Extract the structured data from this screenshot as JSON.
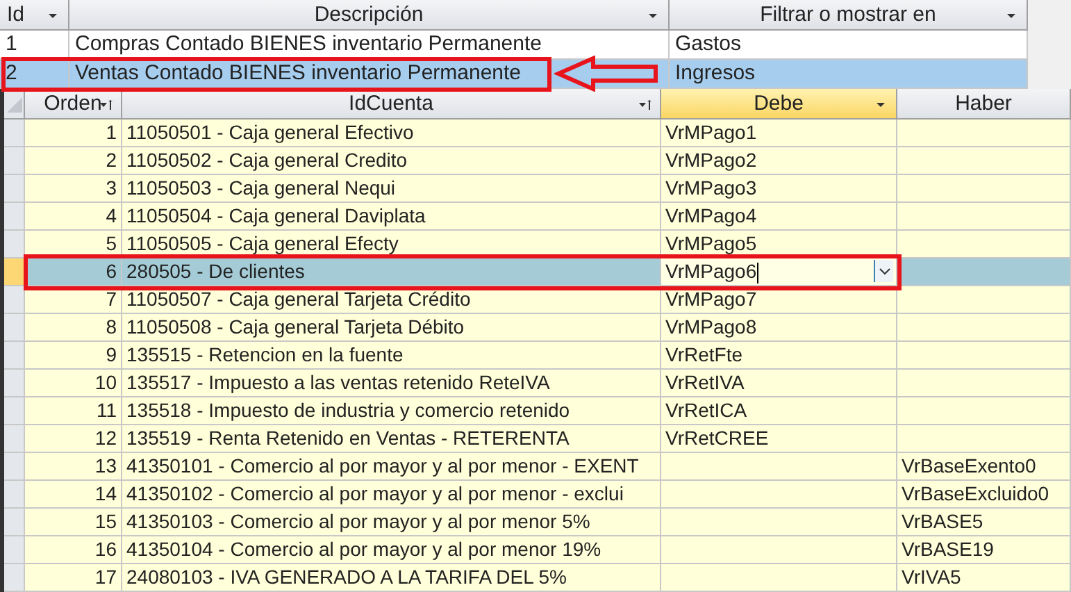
{
  "master": {
    "columns": [
      {
        "label": "Id",
        "kind": "filter"
      },
      {
        "label": "Descripción",
        "kind": "filter"
      },
      {
        "label": "Filtrar o mostrar en",
        "kind": "filter"
      }
    ],
    "rows": [
      {
        "id": "1",
        "descripcion": "Compras Contado BIENES inventario Permanente",
        "filtrar": "Gastos",
        "selected": false,
        "annotated": false
      },
      {
        "id": "2",
        "descripcion": "Ventas Contado BIENES inventario Permanente",
        "filtrar": "Ingresos",
        "selected": true,
        "annotated": true
      }
    ]
  },
  "detail": {
    "columns": [
      {
        "label": "Orden",
        "kind": "sorted",
        "selected": false
      },
      {
        "label": "IdCuenta",
        "kind": "sorted",
        "selected": false
      },
      {
        "label": "Debe",
        "kind": "filter",
        "selected": true
      },
      {
        "label": "Haber",
        "kind": "plain",
        "selected": false
      }
    ],
    "rows": [
      {
        "orden": "1",
        "idcuenta": "11050501 - Caja general Efectivo",
        "debe": "VrMPago1",
        "selected": false
      },
      {
        "orden": "2",
        "idcuenta": "11050502 - Caja general Credito",
        "debe": "VrMPago2",
        "selected": false
      },
      {
        "orden": "3",
        "idcuenta": "11050503 - Caja general Nequi",
        "debe": "VrMPago3",
        "selected": false
      },
      {
        "orden": "4",
        "idcuenta": "11050504 - Caja general Daviplata",
        "debe": "VrMPago4",
        "selected": false
      },
      {
        "orden": "5",
        "idcuenta": "11050505 - Caja general Efecty",
        "debe": "VrMPago5",
        "selected": false
      },
      {
        "orden": "6",
        "idcuenta": "280505 - De clientes",
        "debe": "VrMPago6",
        "selected": true,
        "editing": true,
        "annotated": true
      },
      {
        "orden": "7",
        "idcuenta": "11050507 - Caja general Tarjeta Crédito",
        "debe": "VrMPago7",
        "selected": false
      },
      {
        "orden": "8",
        "idcuenta": "11050508 - Caja general Tarjeta Débito",
        "debe": "VrMPago8",
        "selected": false
      },
      {
        "orden": "9",
        "idcuenta": "135515 - Retencion en la fuente",
        "debe": "VrRetFte",
        "selected": false
      },
      {
        "orden": "10",
        "idcuenta": "135517 - Impuesto a las ventas retenido ReteIVA",
        "debe": "VrRetIVA",
        "selected": false
      },
      {
        "orden": "11",
        "idcuenta": "135518 - Impuesto de industria y comercio retenido",
        "debe": "VrRetICA",
        "selected": false
      },
      {
        "orden": "12",
        "idcuenta": "135519 - Renta Retenido en Ventas - RETERENTA",
        "debe": "VrRetCREE",
        "selected": false
      },
      {
        "orden": "13",
        "idcuenta": "41350101 - Comercio al por mayor y al por menor - EXENT",
        "haber": "VrBaseExento0",
        "selected": false
      },
      {
        "orden": "14",
        "idcuenta": "41350102 - Comercio al por mayor y al por menor - exclui",
        "haber": "VrBaseExcluido0",
        "selected": false
      },
      {
        "orden": "15",
        "idcuenta": "41350103 - Comercio al por mayor y al por menor 5%",
        "haber": "VrBASE5",
        "selected": false
      },
      {
        "orden": "16",
        "idcuenta": "41350104 - Comercio al por mayor y al por menor 19%",
        "haber": "VrBASE19",
        "selected": false
      },
      {
        "orden": "17",
        "idcuenta": "24080103 - IVA GENERADO A LA TARIFA DEL 5%",
        "haber": "VrIVA5",
        "selected": false
      }
    ]
  }
}
